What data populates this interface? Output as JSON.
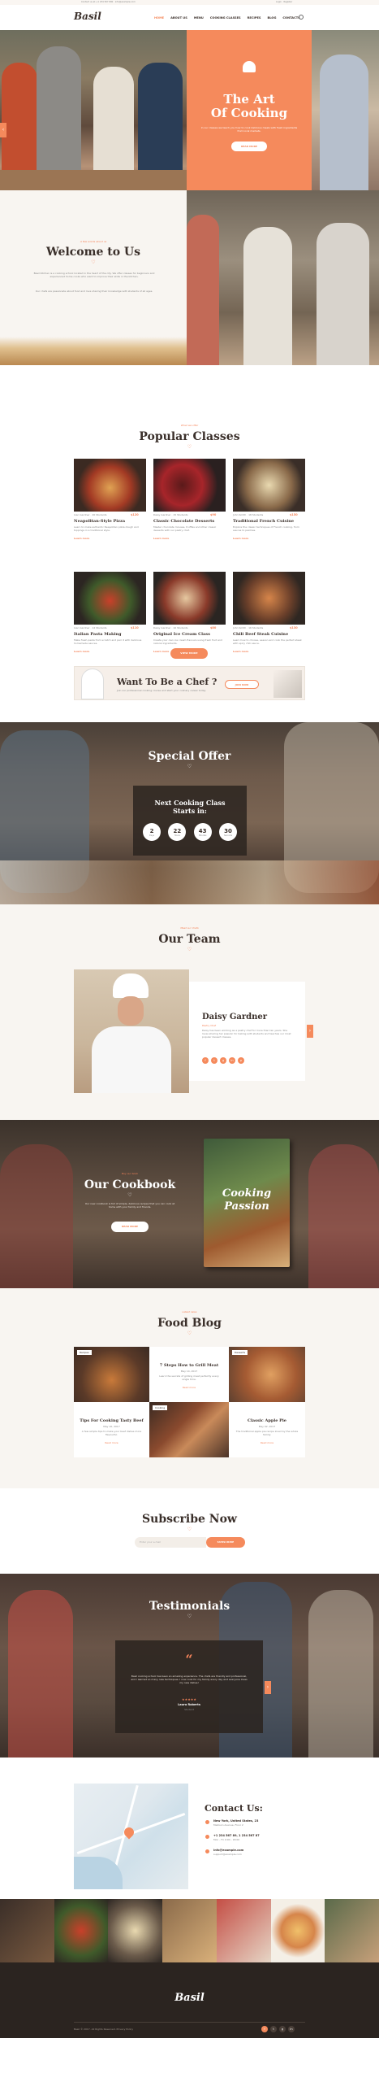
{
  "topbar": {
    "left_text": "Contact us at +1 234 567 890 · info@example.com",
    "right_text": "Login · Register"
  },
  "nav": {
    "logo": "Basil",
    "items": [
      "HOME",
      "ABOUT US",
      "MENU",
      "COOKING CLASSES",
      "RECIPES",
      "BLOG",
      "CONTACTS"
    ],
    "active_index": 0
  },
  "hero": {
    "title_line1": "The Art",
    "title_line2": "Of Cooking",
    "subtitle": "In our classes we teach you how to cook delicious meals with fresh ingredients from local markets.",
    "button": "READ MORE"
  },
  "welcome": {
    "eyebrow": "A few words about us",
    "title": "Welcome to Us",
    "para1": "Basil Kitchen is a cooking school located in the heart of the city. We offer classes for beginners and experienced home cooks who want to improve their skills in the kitchen.",
    "para2": "Our chefs are passionate about food and love sharing their knowledge with students of all ages."
  },
  "classes": {
    "eyebrow": "What we offer",
    "title": "Popular Classes",
    "items": [
      {
        "title": "Neapolitan-Style Pizza",
        "meta": "Ivan Gardner · 20 Students",
        "price": "$120",
        "desc": "Learn to make authentic Neapolitan pizza dough and toppings in a traditional style.",
        "link": "Learn more"
      },
      {
        "title": "Classic Chocolate Desserts",
        "meta": "Daisy Gardner · 15 Students",
        "price": "$90",
        "desc": "Master chocolate mousse, truffles and other classic desserts with our pastry chef.",
        "link": "Learn more"
      },
      {
        "title": "Traditional French Cuisine",
        "meta": "John Smith · 18 Students",
        "price": "$150",
        "desc": "Explore the classic techniques of French cooking, from sauces to pastries.",
        "link": "Learn more"
      },
      {
        "title": "Italian Pasta Making",
        "meta": "Ivan Gardner · 12 Students",
        "price": "$110",
        "desc": "Make fresh pasta from scratch and pair it with delicious homemade sauces.",
        "link": "Learn more"
      },
      {
        "title": "Original Ice Cream Class",
        "meta": "Daisy Gardner · 10 Students",
        "price": "$80",
        "desc": "Create your own ice cream flavours using fresh fruit and natural ingredients.",
        "link": "Learn more"
      },
      {
        "title": "Chili Beef Steak Cuisine",
        "meta": "John Smith · 16 Students",
        "price": "$130",
        "desc": "Learn how to choose, season and cook the perfect steak with spicy chili sauce.",
        "link": "Learn more"
      }
    ],
    "button": "VIEW MORE"
  },
  "chef_banner": {
    "title": "Want To Be a Chef ?",
    "subtitle": "Join our professional cooking course and start your culinary career today.",
    "button": "JOIN NOW"
  },
  "special": {
    "title": "Special Offer",
    "box_title_line1": "Next Cooking Class",
    "box_title_line2": "Starts in:",
    "counters": [
      {
        "value": "2",
        "label": "Days"
      },
      {
        "value": "22",
        "label": "Hours"
      },
      {
        "value": "43",
        "label": "Minutes"
      },
      {
        "value": "30",
        "label": "Seconds"
      }
    ]
  },
  "team": {
    "eyebrow": "Meet our chefs",
    "title": "Our Team",
    "name": "Daisy Gardner",
    "role": "Pastry Chef",
    "bio": "Daisy has been working as a pastry chef for more than ten years. She loves sharing her passion for baking with students and teaches our most popular dessert classes.",
    "socials": [
      "f",
      "t",
      "g",
      "in",
      "p"
    ]
  },
  "cookbook": {
    "eyebrow": "Buy our book",
    "title": "Our Cookbook",
    "text": "Our new cookbook is full of simple, delicious recipes that you can cook at home with your family and friends.",
    "button": "READ MORE",
    "book_title_line1": "Cooking",
    "book_title_line2": "Passion"
  },
  "blog": {
    "eyebrow": "Latest news",
    "title": "Food Blog",
    "posts": [
      {
        "tag": "Recipes",
        "title": "7 Steps How to Grill Meat",
        "date": "May 14, 2017",
        "text": "Learn the secrets of grilling meat perfectly every single time.",
        "link": "Read more"
      },
      {
        "tag": "Cooking",
        "title": "Tips For Cooking Tasty Beef",
        "date": "May 10, 2017",
        "text": "A few simple tips to make your beef dishes more flavourful.",
        "link": "Read more"
      },
      {
        "tag": "Desserts",
        "title": "Classic Apple Pie",
        "date": "May 02, 2017",
        "text": "The traditional apple pie recipe loved by the whole family.",
        "link": "Read more"
      }
    ]
  },
  "subscribe": {
    "title": "Subscribe Now",
    "placeholder": "Enter your e-mail",
    "button": "SUBSCRIBE"
  },
  "testimonials": {
    "title": "Testimonials",
    "quote_mark": "“",
    "text": "Basil cooking school has been an amazing experience. The chefs are friendly and professional, and I learned so many new techniques. I now cook for my family every day and everyone loves my new dishes!",
    "stars": "★★★★★",
    "author": "Laura Roberts",
    "role": "Student"
  },
  "contact": {
    "title": "Contact Us:",
    "address": "New York, United States, 23",
    "address_sub": "Madison Avenue, Floor 2",
    "phone": "+1 234 567 89, 1 234 567 87",
    "phone_sub": "Mon - Fri 9:00 - 18:00",
    "email": "info@example.com",
    "email_sub": "support@example.com"
  },
  "footer": {
    "logo": "Basil",
    "copyright": "Basil © 2017. All Rights Reserved. Privacy Policy",
    "socials": [
      "f",
      "t",
      "g",
      "in"
    ]
  },
  "colors": {
    "accent": "#f58a5c",
    "dark": "#2b2420",
    "cream": "#f7f4ef"
  }
}
